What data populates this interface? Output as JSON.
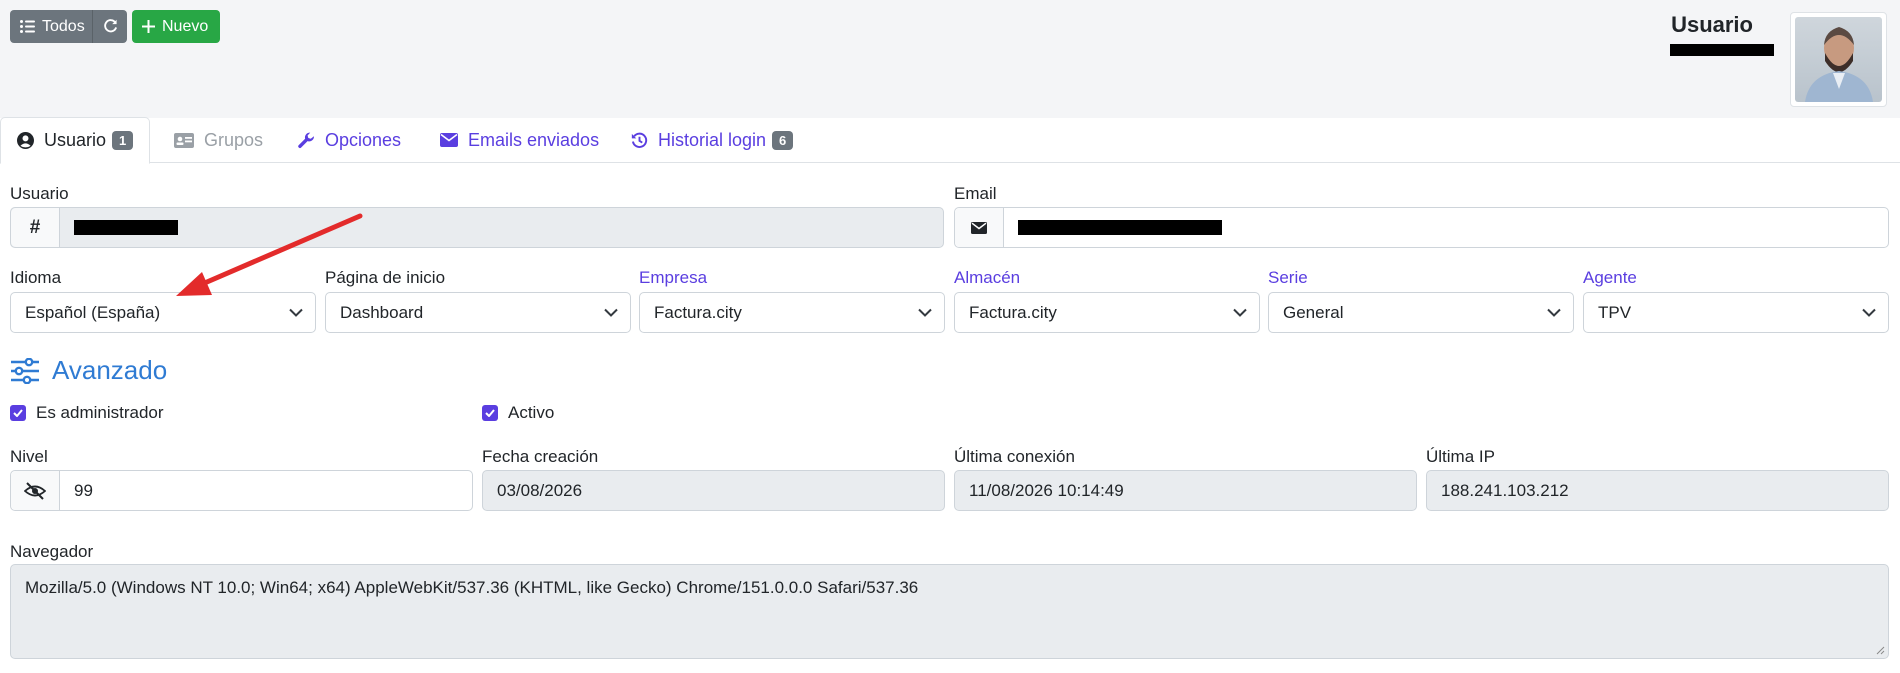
{
  "toolbar": {
    "all_label": "Todos",
    "new_label": "Nuevo"
  },
  "header": {
    "title": "Usuario"
  },
  "tabs": [
    {
      "label": "Usuario",
      "badge": "1",
      "icon": "user-circle-icon",
      "active": true
    },
    {
      "label": "Grupos",
      "icon": "id-card-icon",
      "disabled": true
    },
    {
      "label": "Opciones",
      "icon": "wrench-icon"
    },
    {
      "label": "Emails enviados",
      "icon": "envelope-icon"
    },
    {
      "label": "Historial login",
      "badge": "6",
      "icon": "history-icon"
    }
  ],
  "form": {
    "usuario": {
      "label": "Usuario",
      "addon": "#"
    },
    "email": {
      "label": "Email"
    },
    "idioma": {
      "label": "Idioma",
      "value": "Español (España)"
    },
    "pagina_inicio": {
      "label": "Página de inicio",
      "value": "Dashboard"
    },
    "empresa": {
      "label": "Empresa",
      "value": "Factura.city"
    },
    "almacen": {
      "label": "Almacén",
      "value": "Factura.city"
    },
    "serie": {
      "label": "Serie",
      "value": "General"
    },
    "agente": {
      "label": "Agente",
      "value": "TPV"
    }
  },
  "avanzado": {
    "title": "Avanzado",
    "es_admin": {
      "label": "Es administrador",
      "checked": true
    },
    "activo": {
      "label": "Activo",
      "checked": true
    },
    "nivel": {
      "label": "Nivel",
      "value": "99"
    },
    "fecha_creacion": {
      "label": "Fecha creación",
      "value": "03/08/2026"
    },
    "ultima_conexion": {
      "label": "Última conexión",
      "value": "11/08/2026 10:14:49"
    },
    "ultima_ip": {
      "label": "Última IP",
      "value": "188.241.103.212"
    },
    "navegador": {
      "label": "Navegador",
      "value": "Mozilla/5.0 (Windows NT 10.0; Win64; x64) AppleWebKit/537.36 (KHTML, like Gecko) Chrome/151.0.0.0 Safari/537.36"
    }
  },
  "colors": {
    "primary": "#5a3ee0",
    "success": "#28a745",
    "secondary": "#6c757d",
    "section": "#2f7bd3",
    "annotation": "#e32b2b"
  }
}
